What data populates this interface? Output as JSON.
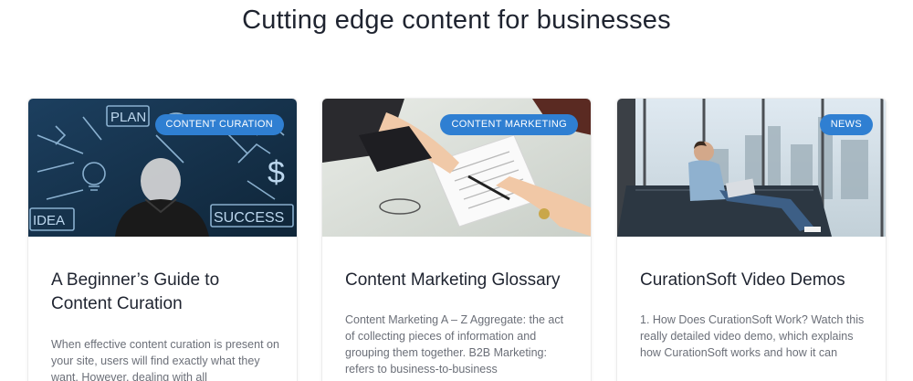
{
  "section": {
    "title": "Cutting edge content for businesses"
  },
  "cards": [
    {
      "category": "CONTENT CURATION",
      "title": "A Beginner’s Guide to Content Curation",
      "excerpt": "When effective content curation is present on your site, users will find exactly what they want. However, dealing with all",
      "image_text": [
        "PLAN",
        "IDEA",
        "SUCCESS",
        "$"
      ]
    },
    {
      "category": "CONTENT MARKETING",
      "title": "Content Marketing Glossary",
      "excerpt": "Content Marketing A – Z Aggregate: the act of collecting pieces of information and grouping them together. B2B Marketing: refers to business-to-business"
    },
    {
      "category": "NEWS",
      "title": "CurationSoft Video Demos",
      "excerpt": "1. How Does CurationSoft Work? Watch this really detailed video demo, which explains how CurationSoft works and how it can"
    }
  ],
  "colors": {
    "badge": "#2f7fd2",
    "title": "#1f2430",
    "excerpt": "#6b6f78"
  }
}
